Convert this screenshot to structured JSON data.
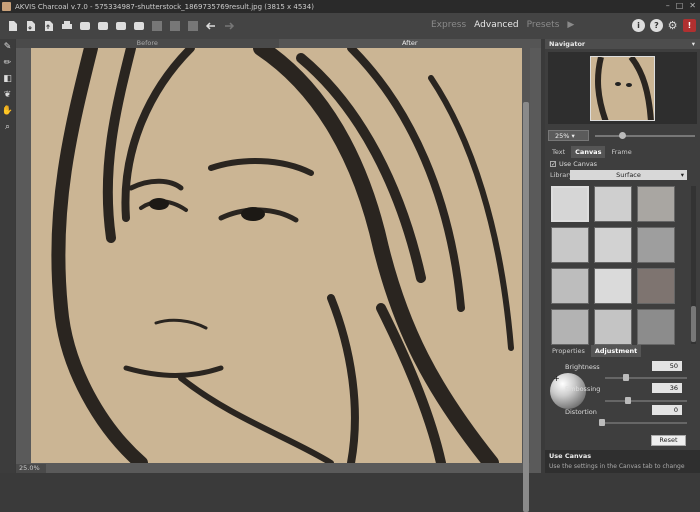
{
  "titlebar": {
    "title": "AKVIS Charcoal v.7.0 - 575334987-shutterstock_1869735769result.jpg (3815 x 4534)"
  },
  "modes": {
    "express": "Express",
    "advanced": "Advanced",
    "presets": "Presets"
  },
  "view_tabs": {
    "before": "Before",
    "after": "After"
  },
  "status": {
    "zoom": "25.0%"
  },
  "navigator": {
    "title": "Navigator",
    "zoom": "25%"
  },
  "settings_tabs": {
    "text": "Text",
    "canvas": "Canvas",
    "frame": "Frame"
  },
  "canvas": {
    "use_canvas_label": "Use Canvas",
    "library_label": "Library",
    "library_value": "Surface"
  },
  "adjust_tabs": {
    "properties": "Properties",
    "adjustment": "Adjustment"
  },
  "adjustment": {
    "brightness_label": "Brightness",
    "brightness": "50",
    "embossing_label": "Embossing",
    "embossing": "36",
    "distortion_label": "Distortion",
    "distortion": "0",
    "reset": "Reset"
  },
  "hint": {
    "title": "Use Canvas",
    "text": "Use the settings in the Canvas tab to change"
  },
  "colors": {
    "canvas_tone": "#cbb594",
    "panel": "#3e3e3e"
  }
}
